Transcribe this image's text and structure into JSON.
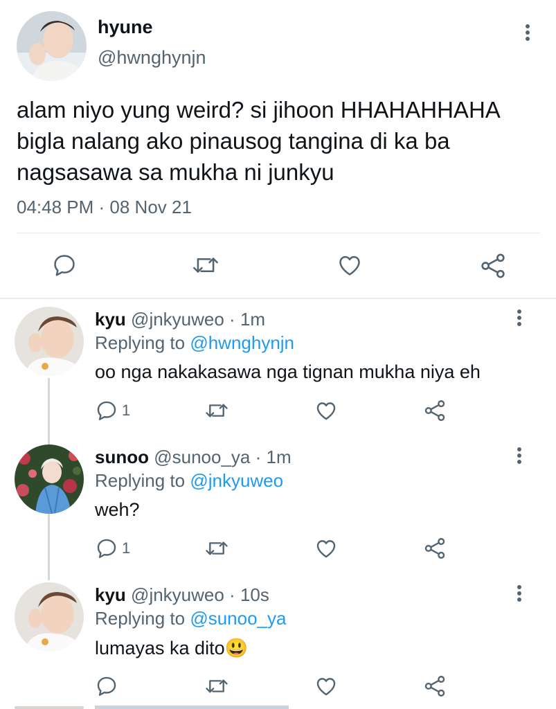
{
  "main_tweet": {
    "display_name": "hyune",
    "handle": "@hwnghynjn",
    "text": [
      "alam niyo yung weird? si jihoon HHAHAHHAHA",
      "bigla nalang ako pinausog tangina di ka ba",
      "nagsasawa sa mukha ni junkyu"
    ],
    "timestamp": "04:48 PM · 08 Nov 21"
  },
  "replies": [
    {
      "display_name": "kyu",
      "meta": "@jnkyuweo · 1m",
      "replying_prefix": "Replying to ",
      "replying_to": "@hwnghynjn",
      "text": "oo nga nakakasawa nga tignan mukha niya eh",
      "reply_count": "1"
    },
    {
      "display_name": "sunoo",
      "meta": "@sunoo_ya · 1m",
      "replying_prefix": "Replying to ",
      "replying_to": "@jnkyuweo",
      "text": "weh?",
      "reply_count": "1"
    },
    {
      "display_name": "kyu",
      "meta": "@jnkyuweo · 10s",
      "replying_prefix": "Replying to ",
      "replying_to": "@sunoo_ya",
      "text": "lumayas ka dito",
      "emoji": "😃",
      "reply_count": ""
    }
  ],
  "icons": [
    "reply-icon",
    "retweet-icon",
    "like-icon",
    "share-icon",
    "more-options-icon"
  ],
  "colors": {
    "link": "#1d9bf0",
    "muted": "#536471",
    "text": "#0f1419",
    "divider": "#e1e8ed",
    "thread_line": "#cfd9de"
  }
}
